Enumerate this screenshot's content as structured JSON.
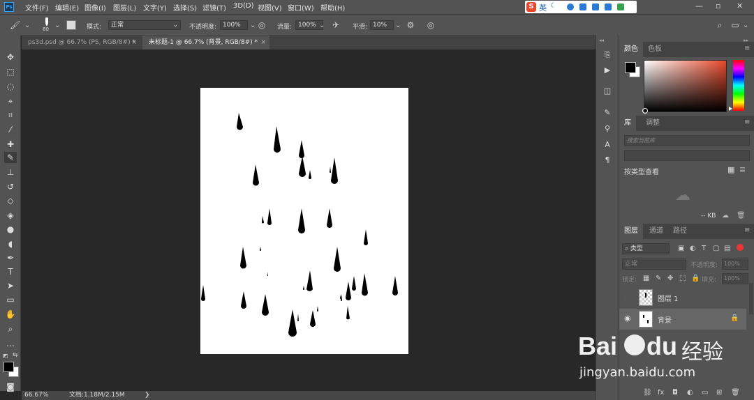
{
  "menubar": {
    "logo": "Ps",
    "items": [
      "文件(F)",
      "编辑(E)",
      "图像(I)",
      "图层(L)",
      "文字(Y)",
      "选择(S)",
      "滤镜(T)",
      "3D(D)",
      "视图(V)",
      "窗口(W)",
      "帮助(H)"
    ],
    "ime_label": "英",
    "window_controls": [
      "—",
      "▫",
      "✕"
    ]
  },
  "options": {
    "brush_size": "80",
    "mode_label": "模式:",
    "mode_value": "正常",
    "opacity_label": "不透明度:",
    "opacity_value": "100%",
    "flow_label": "流量:",
    "flow_value": "100%",
    "smoothing_label": "平滑:",
    "smoothing_value": "10%"
  },
  "tabs": [
    {
      "label": "ps3d.psd @ 66.7% (PS, RGB/8#) *",
      "active": false
    },
    {
      "label": "未标题-1 @ 66.7% (背景, RGB/8#) *",
      "active": true
    }
  ],
  "status": {
    "zoom": "66.67%",
    "doc": "文档:1.18M/2.15M",
    "arrow": "❯"
  },
  "color_panel": {
    "tabs": [
      "颜色",
      "色板"
    ],
    "fg_color": "#000000",
    "bg_color": "#ffffff"
  },
  "library_panel": {
    "tabs": [
      "库",
      "调整"
    ],
    "search_placeholder": "搜索当前库",
    "view_label": "按类型查看",
    "size_label": "-- KB"
  },
  "layers_panel": {
    "tabs": [
      "图层",
      "通道",
      "路径"
    ],
    "filter_label": "类型",
    "blend_mode": "正常",
    "opacity_label": "不透明度:",
    "opacity_value": "100%",
    "lock_label": "锁定:",
    "fill_label": "填充:",
    "fill_value": "100%",
    "layers": [
      {
        "name": "图层 1",
        "visible": false,
        "locked": false
      },
      {
        "name": "背景",
        "visible": true,
        "locked": true
      }
    ],
    "footer_icons": [
      "link-icon",
      "fx-icon",
      "mask-icon",
      "adjustment-icon",
      "group-icon",
      "new-layer-icon",
      "trash-icon"
    ]
  },
  "watermark": {
    "brand": "Bai",
    "brand_tail": "du",
    "cn": "经验",
    "url": "jingyan.baidu.com"
  }
}
